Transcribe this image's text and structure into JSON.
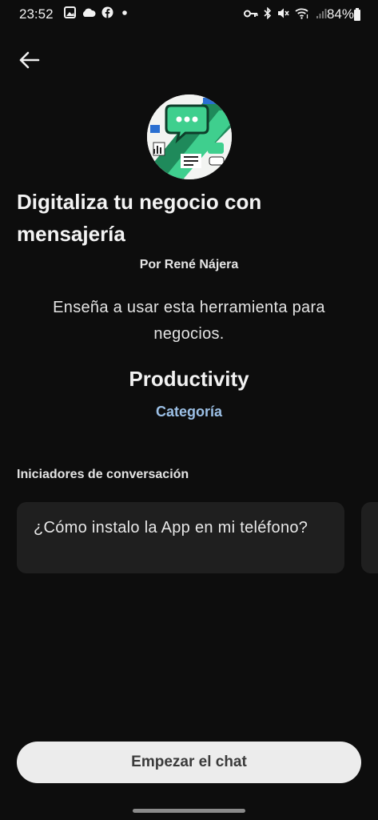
{
  "status_bar": {
    "time": "23:52",
    "left_icons": [
      "gallery-icon",
      "cloud-icon",
      "facebook-icon",
      "dot-icon"
    ],
    "right_icons": [
      "key-icon",
      "bluetooth-icon",
      "mute-icon",
      "wifi-icon",
      "signal-icon"
    ],
    "battery": "84%"
  },
  "header": {
    "back_icon": "arrow-left-icon"
  },
  "gpt": {
    "title": "Digitaliza tu negocio con mensajería",
    "author": "Por René Nájera",
    "description": "Enseña a usar esta herramienta para negocios.",
    "category_value": "Productivity",
    "category_label": "Categoría"
  },
  "starters": {
    "heading": "Iniciadores de conversación",
    "items": [
      "¿Cómo instalo la App en mi teléfono?"
    ]
  },
  "actions": {
    "start_chat": "Empezar el chat"
  },
  "colors": {
    "background": "#0d0d0d",
    "card": "#1f1f1f",
    "accent_link": "#9cc0e6",
    "button": "#ececec"
  }
}
